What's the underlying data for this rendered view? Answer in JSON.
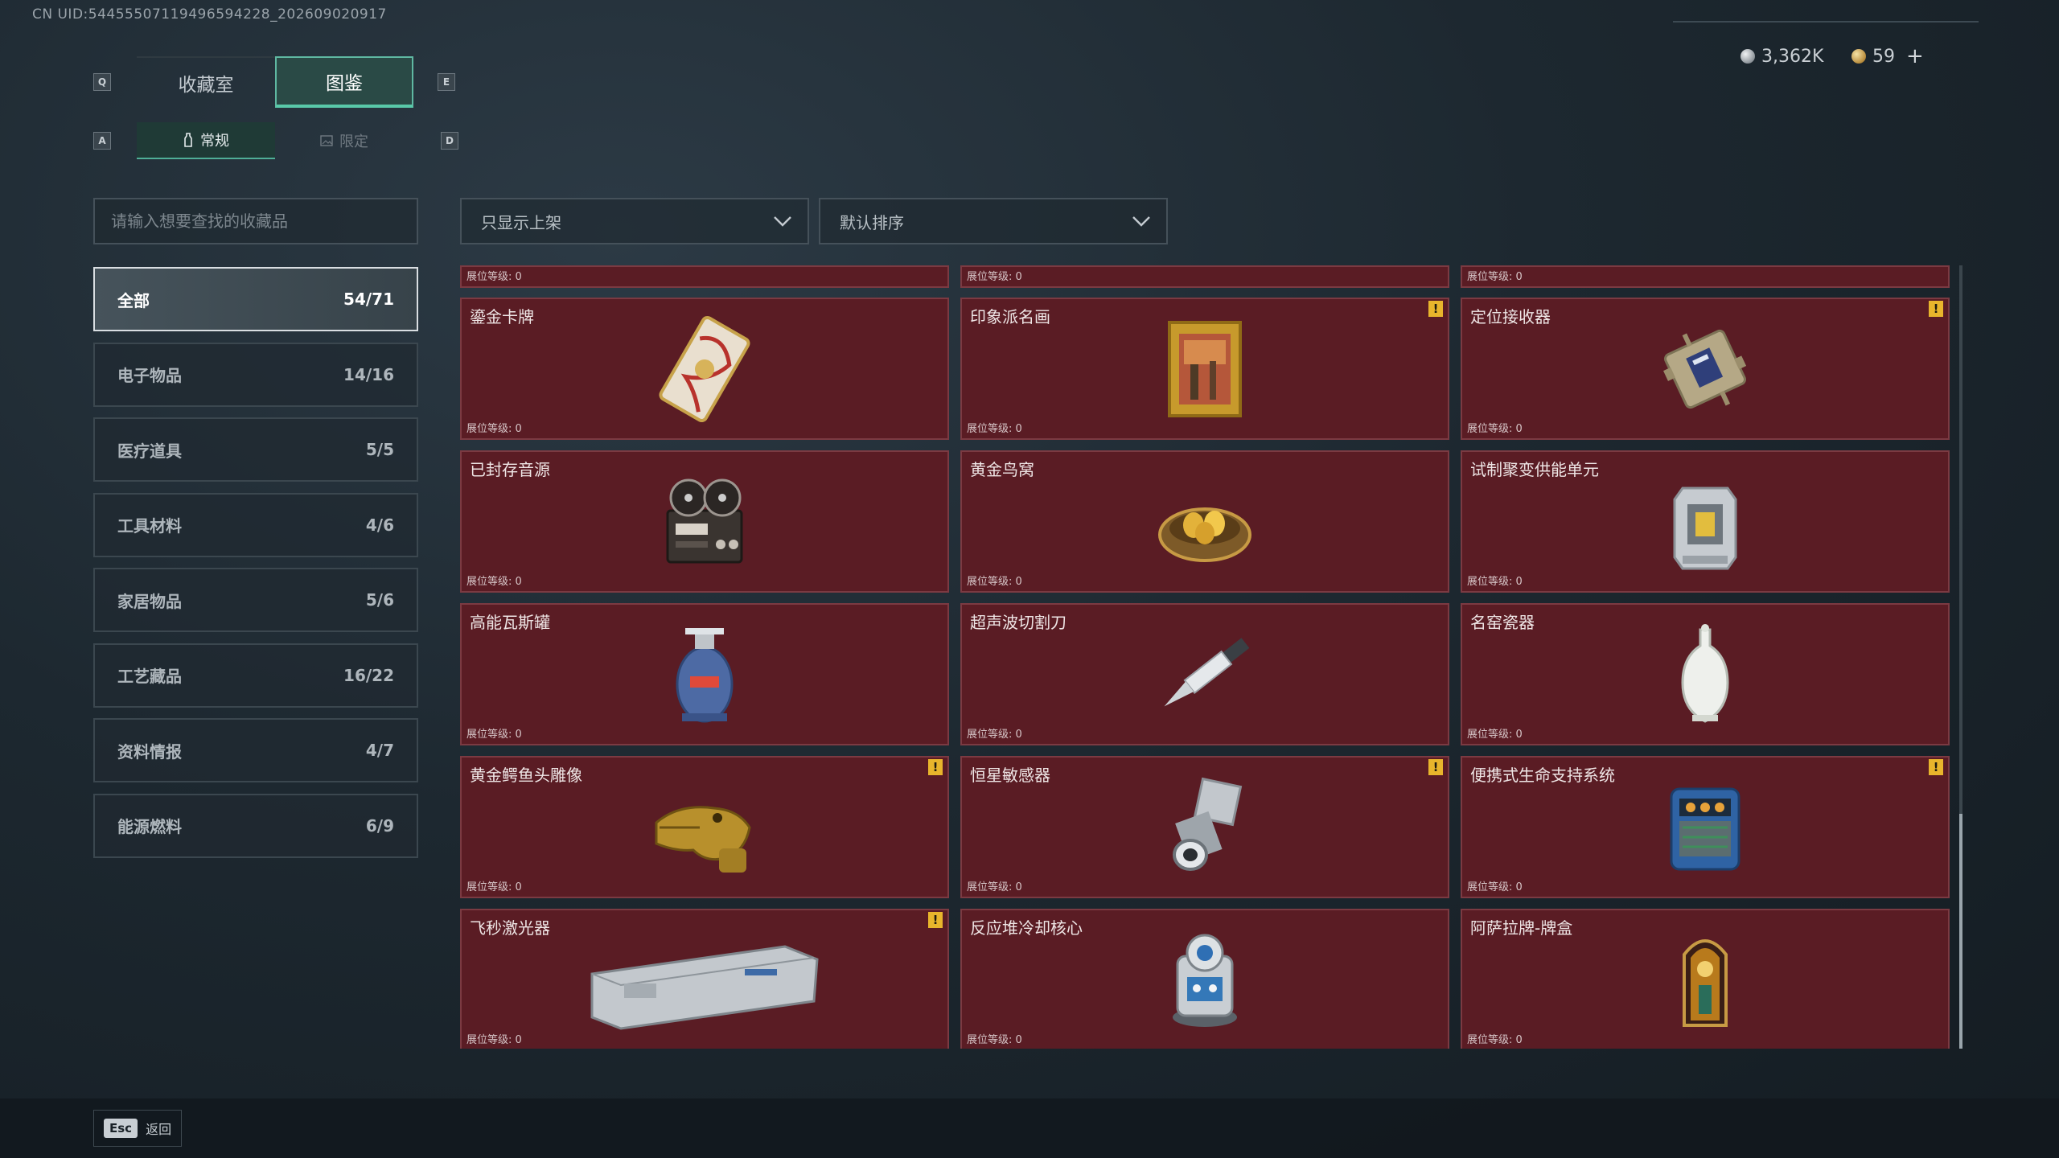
{
  "uid_text": "CN UID:54455507119496594228_202609020917",
  "currency": {
    "silver": "3,362K",
    "gold": "59",
    "plus": "+"
  },
  "main_tabs": {
    "key_left": "Q",
    "key_right": "E",
    "items": [
      {
        "label": "收藏室",
        "active": false
      },
      {
        "label": "图鉴",
        "active": true
      }
    ]
  },
  "sub_tabs": {
    "key_left": "A",
    "key_right": "D",
    "items": [
      {
        "label": "常规",
        "active": true
      },
      {
        "label": "限定",
        "active": false
      }
    ]
  },
  "search": {
    "placeholder": "请输入想要查找的收藏品"
  },
  "filters": {
    "display": "只显示上架",
    "sort": "默认排序"
  },
  "categories": [
    {
      "label": "全部",
      "count": "54/71",
      "active": true
    },
    {
      "label": "电子物品",
      "count": "14/16",
      "active": false
    },
    {
      "label": "医疗道具",
      "count": "5/5",
      "active": false
    },
    {
      "label": "工具材料",
      "count": "4/6",
      "active": false
    },
    {
      "label": "家居物品",
      "count": "5/6",
      "active": false
    },
    {
      "label": "工艺藏品",
      "count": "16/22",
      "active": false
    },
    {
      "label": "资料情报",
      "count": "4/7",
      "active": false
    },
    {
      "label": "能源燃料",
      "count": "6/9",
      "active": false
    }
  ],
  "level_label": "展位等级: 0",
  "items_top_cut": [
    {
      "level": "展位等级: 0"
    },
    {
      "level": "展位等级: 0"
    },
    {
      "level": "展位等级: 0"
    }
  ],
  "items": [
    {
      "name": "鎏金卡牌",
      "level": "展位等级: 0",
      "warn": false,
      "icon": "gilded-card-icon"
    },
    {
      "name": "印象派名画",
      "level": "展位等级: 0",
      "warn": true,
      "icon": "framed-painting-icon"
    },
    {
      "name": "定位接收器",
      "level": "展位等级: 0",
      "warn": true,
      "icon": "positioning-receiver-icon"
    },
    {
      "name": "已封存音源",
      "level": "展位等级: 0",
      "warn": false,
      "icon": "reel-tape-recorder-icon"
    },
    {
      "name": "黄金鸟窝",
      "level": "展位等级: 0",
      "warn": false,
      "icon": "golden-nest-icon"
    },
    {
      "name": "试制聚变供能单元",
      "level": "展位等级: 0",
      "warn": false,
      "icon": "fusion-cell-icon"
    },
    {
      "name": "高能瓦斯罐",
      "level": "展位等级: 0",
      "warn": false,
      "icon": "gas-canister-icon"
    },
    {
      "name": "超声波切割刀",
      "level": "展位等级: 0",
      "warn": false,
      "icon": "ultrasonic-knife-icon"
    },
    {
      "name": "名窑瓷器",
      "level": "展位等级: 0",
      "warn": false,
      "icon": "porcelain-vase-icon"
    },
    {
      "name": "黄金鳄鱼头雕像",
      "level": "展位等级: 0",
      "warn": true,
      "icon": "golden-crocodile-head-icon"
    },
    {
      "name": "恒星敏感器",
      "level": "展位等级: 0",
      "warn": true,
      "icon": "star-sensor-icon"
    },
    {
      "name": "便携式生命支持系统",
      "level": "展位等级: 0",
      "warn": true,
      "icon": "life-support-icon"
    },
    {
      "name": "飞秒激光器",
      "level": "展位等级: 0",
      "warn": true,
      "icon": "femtosecond-laser-icon"
    },
    {
      "name": "反应堆冷却核心",
      "level": "展位等级: 0",
      "warn": false,
      "icon": "reactor-core-icon"
    },
    {
      "name": "阿萨拉牌-牌盒",
      "level": "展位等级: 0",
      "warn": false,
      "icon": "card-box-icon"
    }
  ],
  "warn_glyph": "!",
  "footer": {
    "esc_key": "Esc",
    "back_label": "返回"
  },
  "colors": {
    "accent": "#59c9a9",
    "card_bg": "#5a1c24",
    "warn": "#e8b52c"
  }
}
